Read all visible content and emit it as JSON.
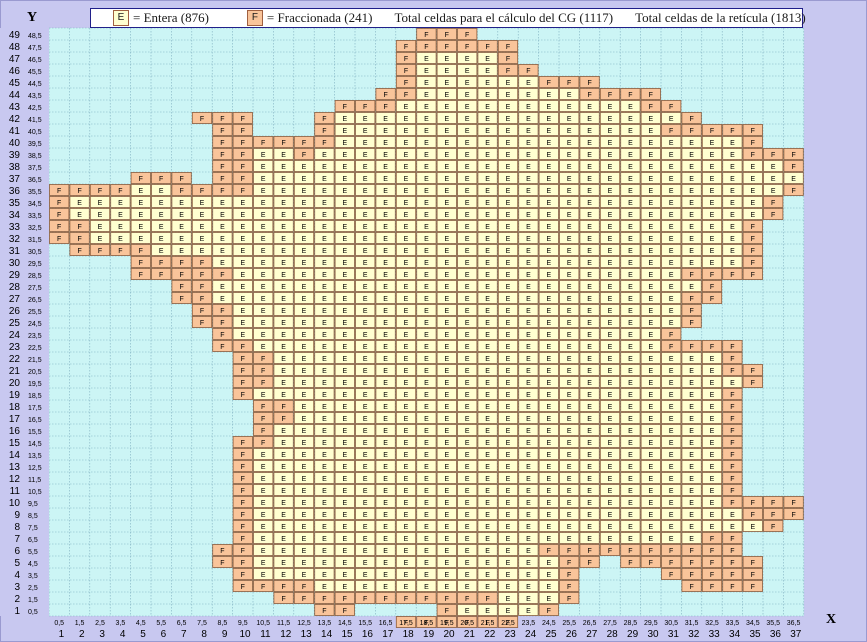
{
  "axis": {
    "y_title": "Y",
    "x_title": "X"
  },
  "legend": {
    "entera_key": "E",
    "entera_label": "= Entera (876)",
    "fraccionada_key": "F",
    "fraccionada_label": "= Fraccionada (241)",
    "total_cg": "Total celdas para el cálculo del CG (1117)",
    "total_reticula": "Total celdas de la retícula (1813)"
  },
  "colors": {
    "background_cell": "#ccf5f5",
    "grid_line": "#7fb0c0",
    "entera_fill": "#ffffd0",
    "fraccionada_fill": "#f9c49a",
    "cell_border": "#8a5a3a",
    "frame": "#c8c8f0"
  },
  "chart_data": {
    "type": "heatmap",
    "columns": 37,
    "rows": 49,
    "x_ticks": [
      "1",
      "2",
      "3",
      "4",
      "5",
      "6",
      "7",
      "8",
      "9",
      "10",
      "11",
      "12",
      "13",
      "14",
      "15",
      "16",
      "17",
      "18",
      "19",
      "20",
      "21",
      "22",
      "23",
      "24",
      "25",
      "26",
      "27",
      "28",
      "29",
      "30",
      "31",
      "32",
      "33",
      "34",
      "35",
      "36",
      "37"
    ],
    "x_midpoints": [
      "0,5",
      "1,5",
      "2,5",
      "3,5",
      "4,5",
      "5,5",
      "6,5",
      "7,5",
      "8,5",
      "9,5",
      "10,5",
      "11,5",
      "12,5",
      "13,5",
      "14,5",
      "15,5",
      "16,5",
      "17,5",
      "18,5",
      "19,5",
      "20,5",
      "21,5",
      "22,5",
      "23,5",
      "24,5",
      "25,5",
      "26,5",
      "27,5",
      "28,5",
      "29,5",
      "30,5",
      "31,5",
      "32,5",
      "33,5",
      "34,5",
      "35,5",
      "36,5"
    ],
    "y_ticks": [
      "49",
      "48",
      "47",
      "46",
      "45",
      "44",
      "43",
      "42",
      "41",
      "40",
      "39",
      "38",
      "37",
      "36",
      "35",
      "34",
      "33",
      "32",
      "31",
      "30",
      "29",
      "28",
      "27",
      "26",
      "25",
      "24",
      "23",
      "22",
      "21",
      "20",
      "19",
      "18",
      "17",
      "16",
      "15",
      "14",
      "13",
      "12",
      "11",
      "10",
      "9",
      "8",
      "7",
      "6",
      "5",
      "4",
      "3",
      "2",
      "1"
    ],
    "y_midpoints": [
      "48,5",
      "47,5",
      "46,5",
      "45,5",
      "44,5",
      "43,5",
      "42,5",
      "41,5",
      "40,5",
      "39,5",
      "38,5",
      "37,5",
      "36,5",
      "35,5",
      "34,5",
      "33,5",
      "32,5",
      "31,5",
      "30,5",
      "29,5",
      "28,5",
      "27,5",
      "26,5",
      "25,5",
      "24,5",
      "23,5",
      "22,5",
      "21,5",
      "20,5",
      "19,5",
      "18,5",
      "17,5",
      "16,5",
      "15,5",
      "14,5",
      "13,5",
      "12,5",
      "11,5",
      "10,5",
      "9,5",
      "8,5",
      "7,5",
      "6,5",
      "5,5",
      "4,5",
      "3,5",
      "2,5",
      "1,5",
      "0,5"
    ],
    "rows_top_to_bottom": [
      "..................FFF................",
      ".................FFFFFF..............",
      ".................FEEEEF..............",
      ".................FEEEEFF.............",
      ".................FEEEEEEFFF..........",
      "................FFEEEEEEEEFFFF.......",
      "..............FFFEEEEEEEEEEEEFF......",
      ".......FFF...FEEEEEEEEEEEEEEEEEF.....",
      "........FF...FEEEEEEEEEEEEEEEEFFFFF..",
      "........FFFFFFEEEEEEEEEEEEEEEEEEEEF..",
      "........FFEEFEEEEEEEEEEEEEEEEEEEEEFFFF",
      "........FFEEEEEEEEEEEEEEEEEEEEEEEEEEFFFF",
      "....FFF.FFEEEEEEEEEEEEEEEEEEEEEEEEEEEEF",
      "FFFFEEFFFFEEEEEEEEEEEEEEEEEEEEEEEEEEF",
      "FEEEEEEEEEEEEEEEEEEEEEEEEEEEEEEEEEEF",
      "FEEEEEEEEEEEEEEEEEEEEEEEEEEEEEEEEEEF",
      "FFEEEEEEEEEEEEEEEEEEEEEEEEEEEEEEEEF.",
      "FFEEEEEEEEEEEEEEEEEEEEEEEEEEEEEEEEF.",
      ".FFFFEEEEEEEEEEEEEEEEEEEEEEEEEEEEEF.",
      "....FFFFEEEEEEEEEEEEEEEEEEEEEEEEEEF.",
      "....FFFFFEEEEEEEEEEEEEEEEEEEEEEFFFF.",
      "......FFEEEEEEEEEEEEEEEEEEEEEEEEF....",
      "......FFEEEEEEEEEEEEEEEEEEEEEEEFF....",
      ".......FFEEEEEEEEEEEEEEEEEEEEEEF.....",
      ".......FFEEEEEEEEEEEEEEEEEEEEEEF.....",
      "........FEEEEEEEEEEEEEEEEEEEEEF......",
      "........FFEEEEEEEEEEEEEEEEEEEEFFFF...",
      ".........FFEEEEEEEEEEEEEEEEEEEEEEF...",
      ".........FFEEEEEEEEEEEEEEEEEEEEEEFF..",
      ".........FFEEEEEEEEEEEEEEEEEEEEEEEF..",
      ".........FEEEEEEEEEEEEEEEEEEEEEEEF...",
      "..........FFEEEEEEEEEEEEEEEEEEEEEF...",
      "..........FFEEEEEEEEEEEEEEEEEEEEEF...",
      "..........FEEEEEEEEEEEEEEEEEEEEEEF...",
      ".........FFEEEEEEEEEEEEEEEEEEEEEEF...",
      ".........FEEEEEEEEEEEEEEEEEEEEEEEF...",
      ".........FEEEEEEEEEEEEEEEEEEEEEEEF...",
      ".........FEEEEEEEEEEEEEEEEEEEEEEEF...",
      ".........FEEEEEEEEEEEEEEEEEEEEEEEF...",
      ".........FEEEEEEEEEEEEEEEEEEEEEEEFFFF",
      ".........FEEEEEEEEEEEEEEEEEEEEEEEEFFF",
      ".........FEEEEEEEEEEEEEEEEEEEEEEEEEF.",
      ".........FEEEEEEEEEEEEEEEEEEEEEEFF...",
      "........FFEEEEEEEEEEEEEEFFFFFFFFFF...",
      "........FFEEEEEEEEEEEEEEEFF.FFFFFFF..",
      ".........FEEEEEEEEEEEEEEEF....FFFFF..",
      ".........FFFFEEEEEEEEEEEEF.....FFFF..",
      "...........FFFFFFFFFFFEEEF...........",
      ".............FF....FEEEEF............",
      ".................FFFFFF.............."
    ]
  }
}
